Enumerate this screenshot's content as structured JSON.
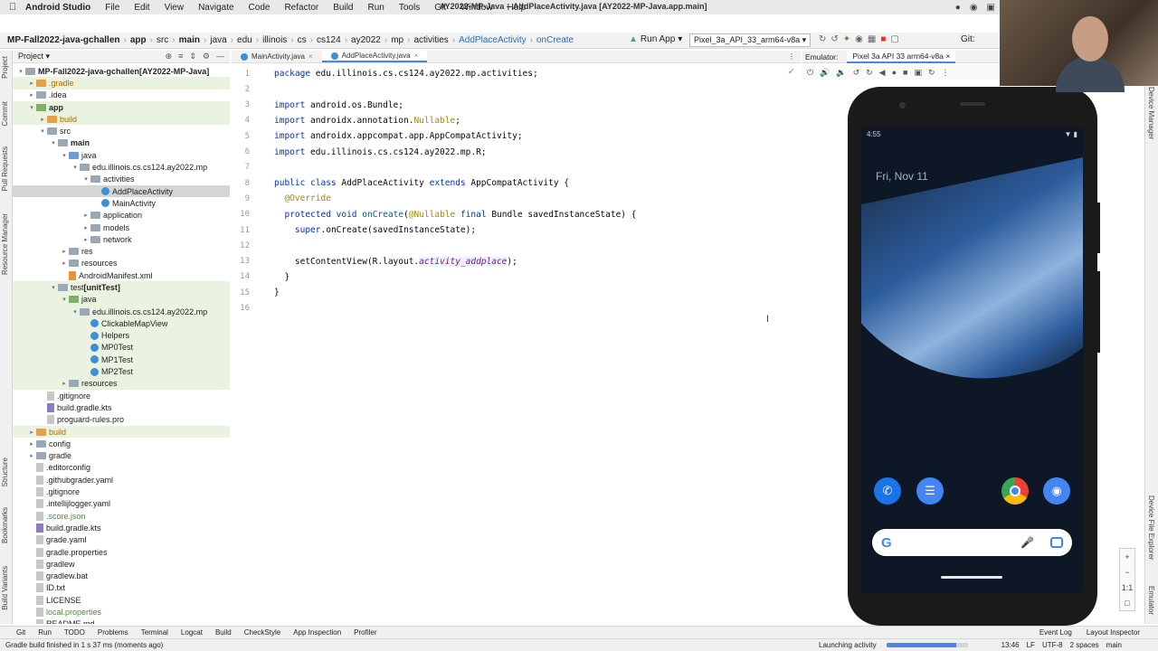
{
  "menubar": {
    "app_name": "Android Studio",
    "items": [
      "File",
      "Edit",
      "View",
      "Navigate",
      "Code",
      "Refactor",
      "Build",
      "Run",
      "Tools",
      "Git",
      "Window",
      "Help"
    ],
    "window_title": "AY2022-MP-Java – AddPlaceActivity.java [AY2022-MP-Java.app.main]"
  },
  "navbar": {
    "crumbs": [
      "MP-Fall2022-java-gchallen",
      "app",
      "src",
      "main",
      "java",
      "edu",
      "illinois",
      "cs",
      "cs124",
      "ay2022",
      "mp",
      "activities",
      "AddPlaceActivity",
      "onCreate"
    ],
    "run_label": "Run App",
    "device": "Pixel_3a_API_33_arm64-v8a",
    "git_label": "Git:"
  },
  "left_strip": [
    "Project",
    "Commit",
    "Pull Requests",
    "Resource Manager",
    "Structure",
    "Bookmarks",
    "Build Variants"
  ],
  "project_panel": {
    "title": "Project",
    "tree": [
      {
        "label": "MP-Fall2022-java-gchallen",
        "extra": "[AY2022-MP-Java]",
        "indent": 0,
        "arrow": "▾",
        "icon": "folder",
        "style": "bold"
      },
      {
        "label": ".gradle",
        "indent": 1,
        "arrow": "▸",
        "icon": "folder-orange",
        "style": "orange",
        "bg": "green"
      },
      {
        "label": ".idea",
        "indent": 1,
        "arrow": "▸",
        "icon": "folder"
      },
      {
        "label": "app",
        "indent": 1,
        "arrow": "▾",
        "icon": "folder-green",
        "style": "bold",
        "bg": "green"
      },
      {
        "label": "build",
        "indent": 2,
        "arrow": "▸",
        "icon": "folder-orange",
        "style": "orange",
        "bg": "green"
      },
      {
        "label": "src",
        "indent": 2,
        "arrow": "▾",
        "icon": "folder"
      },
      {
        "label": "main",
        "indent": 3,
        "arrow": "▾",
        "icon": "folder",
        "style": "bold"
      },
      {
        "label": "java",
        "indent": 4,
        "arrow": "▾",
        "icon": "folder-blue"
      },
      {
        "label": "edu.illinois.cs.cs124.ay2022.mp",
        "indent": 5,
        "arrow": "▾",
        "icon": "folder"
      },
      {
        "label": "activities",
        "indent": 6,
        "arrow": "▾",
        "icon": "folder"
      },
      {
        "label": "AddPlaceActivity",
        "indent": 7,
        "arrow": "",
        "icon": "class",
        "bg": "sel"
      },
      {
        "label": "MainActivity",
        "indent": 7,
        "arrow": "",
        "icon": "class"
      },
      {
        "label": "application",
        "indent": 6,
        "arrow": "▸",
        "icon": "folder"
      },
      {
        "label": "models",
        "indent": 6,
        "arrow": "▸",
        "icon": "folder"
      },
      {
        "label": "network",
        "indent": 6,
        "arrow": "▸",
        "icon": "folder"
      },
      {
        "label": "res",
        "indent": 4,
        "arrow": "▸",
        "icon": "folder"
      },
      {
        "label": "resources",
        "indent": 4,
        "arrow": "▸",
        "icon": "folder"
      },
      {
        "label": "AndroidManifest.xml",
        "indent": 4,
        "arrow": "",
        "icon": "xml"
      },
      {
        "label": "test",
        "extra": "[unitTest]",
        "indent": 3,
        "arrow": "▾",
        "icon": "folder",
        "bg": "green"
      },
      {
        "label": "java",
        "indent": 4,
        "arrow": "▾",
        "icon": "folder-green",
        "bg": "green"
      },
      {
        "label": "edu.illinois.cs.cs124.ay2022.mp",
        "indent": 5,
        "arrow": "▾",
        "icon": "folder",
        "bg": "green"
      },
      {
        "label": "ClickableMapView",
        "indent": 6,
        "arrow": "",
        "icon": "class",
        "bg": "green"
      },
      {
        "label": "Helpers",
        "indent": 6,
        "arrow": "",
        "icon": "class",
        "bg": "green"
      },
      {
        "label": "MP0Test",
        "indent": 6,
        "arrow": "",
        "icon": "class",
        "bg": "green"
      },
      {
        "label": "MP1Test",
        "indent": 6,
        "arrow": "",
        "icon": "class",
        "bg": "green"
      },
      {
        "label": "MP2Test",
        "indent": 6,
        "arrow": "",
        "icon": "class",
        "bg": "green"
      },
      {
        "label": "resources",
        "indent": 4,
        "arrow": "▸",
        "icon": "folder",
        "bg": "green"
      },
      {
        "label": ".gitignore",
        "indent": 2,
        "arrow": "",
        "icon": "file"
      },
      {
        "label": "build.gradle.kts",
        "indent": 2,
        "arrow": "",
        "icon": "kt"
      },
      {
        "label": "proguard-rules.pro",
        "indent": 2,
        "arrow": "",
        "icon": "file"
      },
      {
        "label": "build",
        "indent": 1,
        "arrow": "▸",
        "icon": "folder-orange",
        "style": "orange",
        "bg": "green"
      },
      {
        "label": "config",
        "indent": 1,
        "arrow": "▸",
        "icon": "folder"
      },
      {
        "label": "gradle",
        "indent": 1,
        "arrow": "▸",
        "icon": "folder"
      },
      {
        "label": ".editorconfig",
        "indent": 1,
        "arrow": "",
        "icon": "file"
      },
      {
        "label": ".githubgrader.yaml",
        "indent": 1,
        "arrow": "",
        "icon": "file"
      },
      {
        "label": ".gitignore",
        "indent": 1,
        "arrow": "",
        "icon": "file"
      },
      {
        "label": ".intellijlogger.yaml",
        "indent": 1,
        "arrow": "",
        "icon": "file"
      },
      {
        "label": ".score.json",
        "indent": 1,
        "arrow": "",
        "icon": "file",
        "style": "green"
      },
      {
        "label": "build.gradle.kts",
        "indent": 1,
        "arrow": "",
        "icon": "kt"
      },
      {
        "label": "grade.yaml",
        "indent": 1,
        "arrow": "",
        "icon": "file"
      },
      {
        "label": "gradle.properties",
        "indent": 1,
        "arrow": "",
        "icon": "file"
      },
      {
        "label": "gradlew",
        "indent": 1,
        "arrow": "",
        "icon": "file"
      },
      {
        "label": "gradlew.bat",
        "indent": 1,
        "arrow": "",
        "icon": "file"
      },
      {
        "label": "ID.txt",
        "indent": 1,
        "arrow": "",
        "icon": "file"
      },
      {
        "label": "LICENSE",
        "indent": 1,
        "arrow": "",
        "icon": "file"
      },
      {
        "label": "local.properties",
        "indent": 1,
        "arrow": "",
        "icon": "file",
        "style": "green"
      },
      {
        "label": "README.md",
        "indent": 1,
        "arrow": "",
        "icon": "file"
      }
    ]
  },
  "editor": {
    "tabs": [
      {
        "label": "MainActivity.java",
        "active": false
      },
      {
        "label": "AddPlaceActivity.java",
        "active": true
      }
    ],
    "lines": [
      {
        "n": "1",
        "html": "<span class=\"kw\">package</span> edu.illinois.cs.cs124.ay2022.mp.activities;"
      },
      {
        "n": "2",
        "html": ""
      },
      {
        "n": "3",
        "html": "<span class=\"kw\">import</span> android.os.Bundle;"
      },
      {
        "n": "4",
        "html": "<span class=\"kw\">import</span> androidx.annotation.<span class=\"ann\">Nullable</span>;"
      },
      {
        "n": "5",
        "html": "<span class=\"kw\">import</span> androidx.appcompat.app.AppCompatActivity;"
      },
      {
        "n": "6",
        "html": "<span class=\"kw\">import</span> edu.illinois.cs.cs124.ay2022.mp.R;"
      },
      {
        "n": "7",
        "html": ""
      },
      {
        "n": "8",
        "html": "<span class=\"kw\">public class</span> AddPlaceActivity <span class=\"kw\">extends</span> AppCompatActivity {"
      },
      {
        "n": "9",
        "html": "  <span class=\"ann\">@Override</span>"
      },
      {
        "n": "10",
        "html": "  <span class=\"kw\">protected void</span> <span class=\"method\">onCreate</span>(<span class=\"ann\">@Nullable</span> <span class=\"kw\">final</span> Bundle savedInstanceState) {"
      },
      {
        "n": "11",
        "html": "    <span class=\"kw\">super</span>.onCreate(savedInstanceState);"
      },
      {
        "n": "12",
        "html": ""
      },
      {
        "n": "13",
        "html": "    setContentView(R.layout.<span class=\"italic-field\">activity_addplace</span>);"
      },
      {
        "n": "14",
        "html": "  }"
      },
      {
        "n": "15",
        "html": "}"
      },
      {
        "n": "16",
        "html": ""
      }
    ]
  },
  "emulator": {
    "label": "Emulator:",
    "device_tab": "Pixel 3a API 33 arm64-v8a",
    "status_time": "4:55",
    "date": "Fri, Nov 11",
    "zoom_label": "1:1"
  },
  "right_strip": [
    "Device Manager",
    "Device File Explorer",
    "Emulator"
  ],
  "bottombar": {
    "left": [
      "Git",
      "Run",
      "TODO",
      "Problems",
      "Terminal",
      "Logcat",
      "Build",
      "CheckStyle",
      "App Inspection",
      "Profiler"
    ],
    "right": [
      "Event Log",
      "Layout Inspector"
    ]
  },
  "statusbar": {
    "message": "Gradle build finished in 1 s 37 ms (moments ago)",
    "progress_label": "Launching activity",
    "progress_fraction": 0.85,
    "right": [
      "13:46",
      "LF",
      "UTF-8",
      "2 spaces",
      "main"
    ]
  },
  "colors": {
    "accent": "#4a86e8",
    "keyword": "#0033b3",
    "annotation": "#9e880d"
  }
}
